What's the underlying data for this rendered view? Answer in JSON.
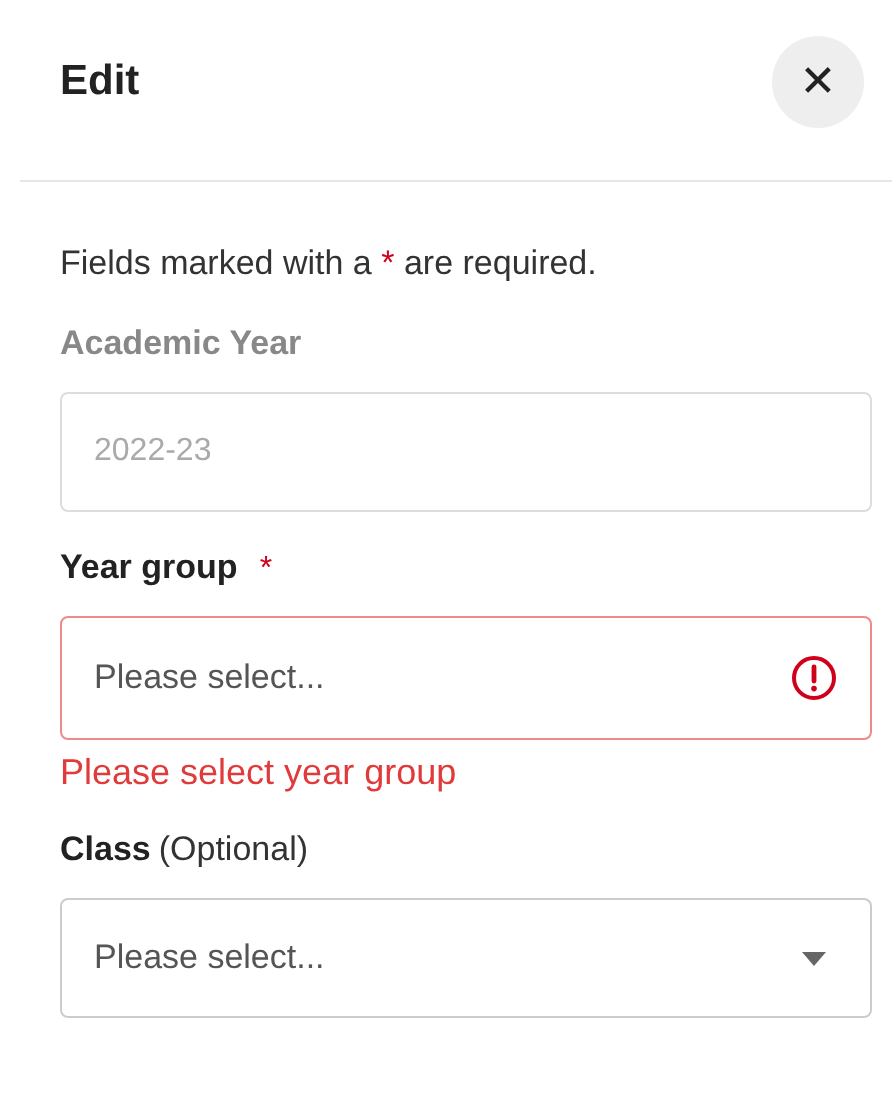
{
  "header": {
    "title": "Edit",
    "close": "✕"
  },
  "note": {
    "before": "Fields marked with a",
    "mark": "*",
    "after": "are required."
  },
  "fields": [
    {
      "label": "Academic Year",
      "kind": "text",
      "disabled": true,
      "value": "2022-23"
    },
    {
      "label": "Year group",
      "required_mark": "*",
      "kind": "select",
      "disabled": false,
      "placeholder": "Please select...",
      "error": "Please select year group"
    },
    {
      "label": "Class",
      "hint": "(Optional)",
      "kind": "select",
      "disabled": false,
      "placeholder": "Please select..."
    }
  ]
}
